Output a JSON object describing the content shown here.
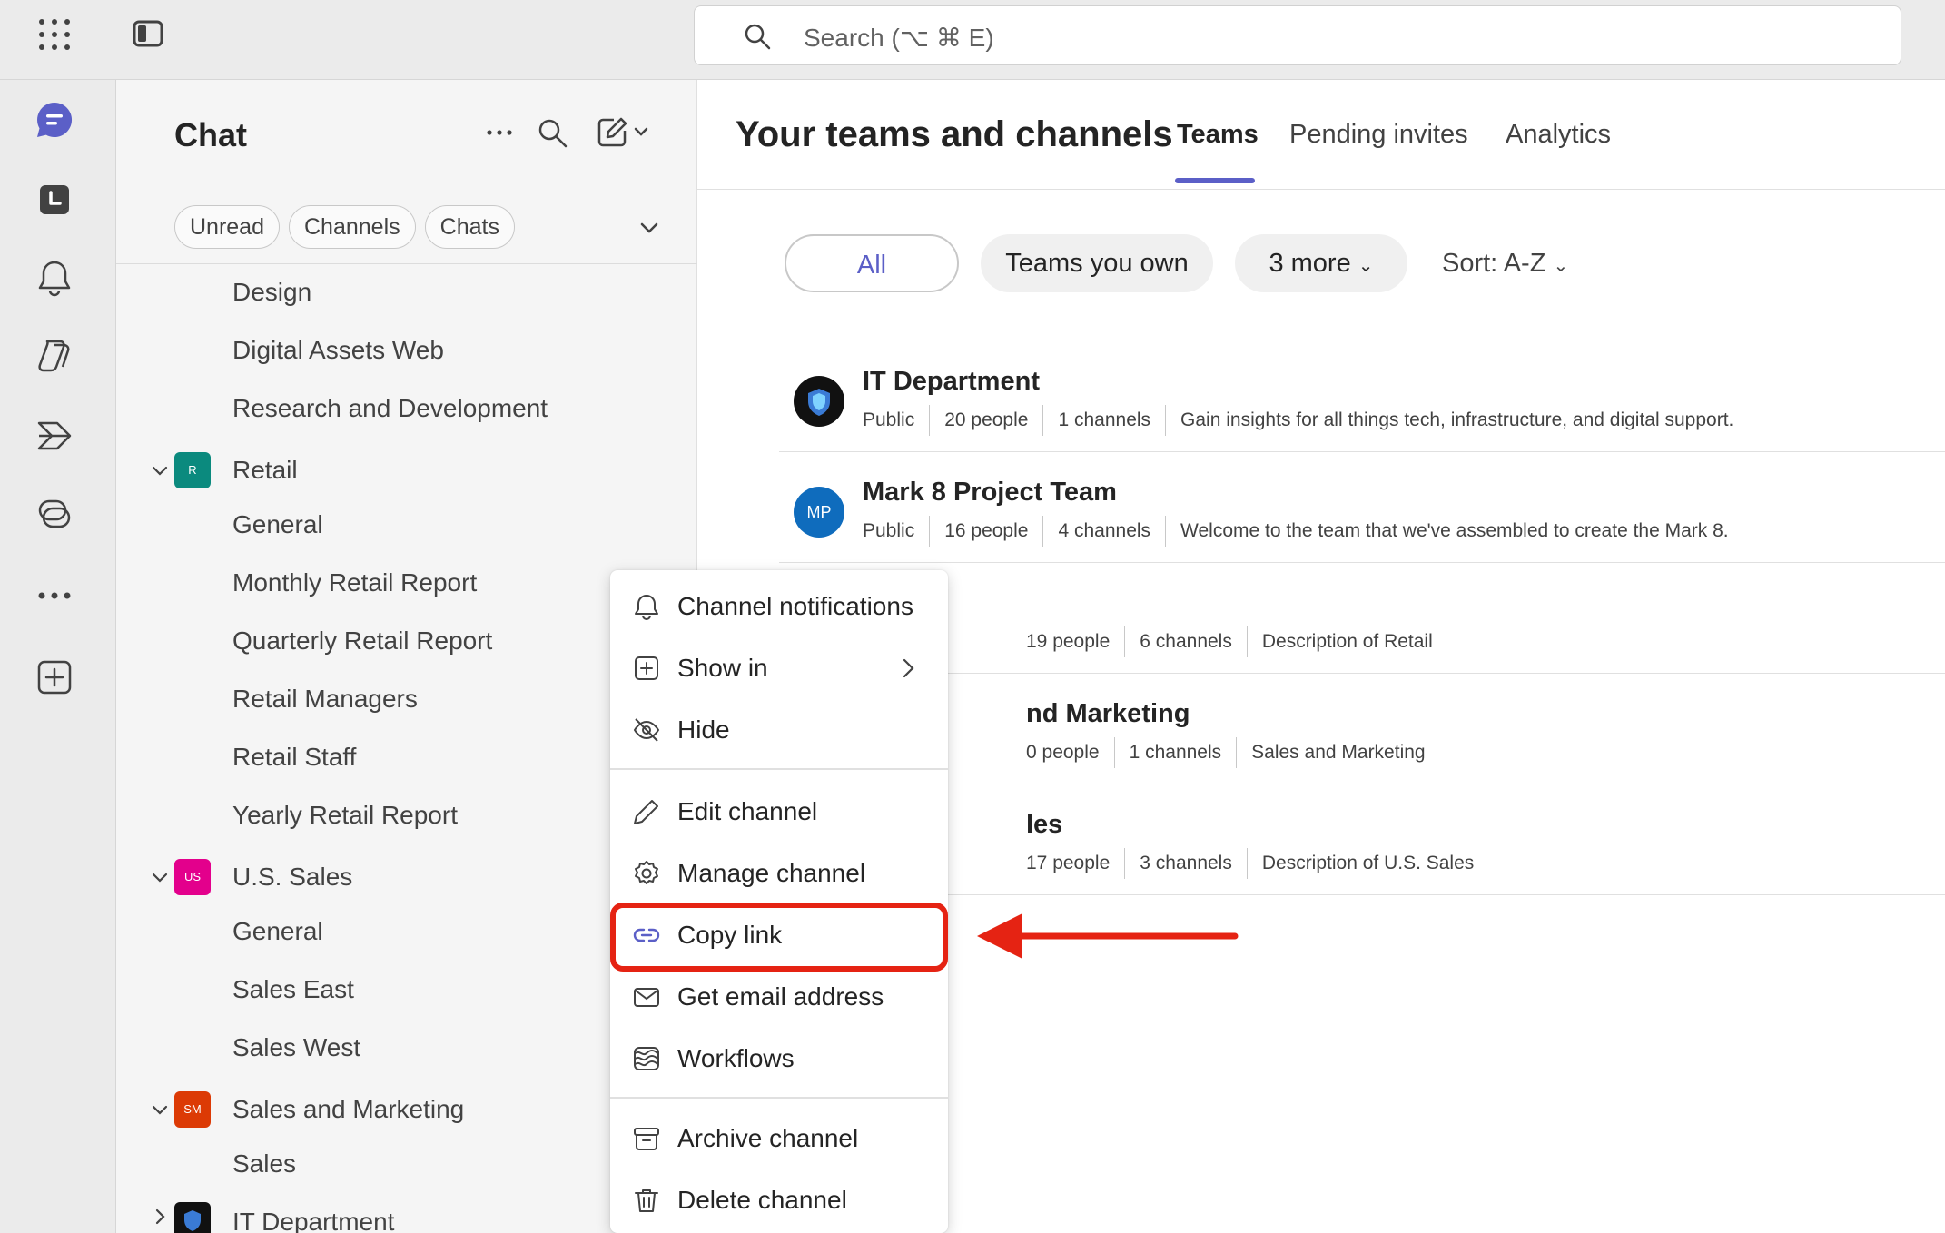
{
  "topbar": {
    "search_placeholder": "Search (⌥ ⌘ E)",
    "icons": [
      "apps-grid-icon",
      "sidebar-toggle-icon",
      "search-icon"
    ]
  },
  "rail": {
    "icons": [
      "chat-icon",
      "calendar-icon",
      "bell-icon",
      "copilot-icon",
      "viva-icon",
      "loop-icon",
      "more-icon",
      "add-app-icon"
    ]
  },
  "chat": {
    "title": "Chat",
    "filters": [
      "Unread",
      "Channels",
      "Chats"
    ],
    "tree": [
      {
        "label": "Design",
        "type": "channel"
      },
      {
        "label": "Digital Assets Web",
        "type": "channel"
      },
      {
        "label": "Research and Development",
        "type": "channel"
      },
      {
        "label": "Retail",
        "type": "team",
        "badge": "R",
        "badge_color": "#0b8a7e"
      },
      {
        "label": "General",
        "type": "channel"
      },
      {
        "label": "Monthly Retail Report",
        "type": "channel"
      },
      {
        "label": "Quarterly Retail Report",
        "type": "channel"
      },
      {
        "label": "Retail Managers",
        "type": "channel"
      },
      {
        "label": "Retail Staff",
        "type": "channel"
      },
      {
        "label": "Yearly Retail Report",
        "type": "channel"
      },
      {
        "label": "U.S. Sales",
        "type": "team",
        "badge": "US",
        "badge_color": "#e3008c"
      },
      {
        "label": "General",
        "type": "channel"
      },
      {
        "label": "Sales East",
        "type": "channel"
      },
      {
        "label": "Sales West",
        "type": "channel"
      },
      {
        "label": "Sales and Marketing",
        "type": "team",
        "badge": "SM",
        "badge_color": "#dc3a05"
      },
      {
        "label": "Sales",
        "type": "channel"
      },
      {
        "label": "IT Department",
        "type": "team",
        "badge": "",
        "badge_color": "#111111"
      }
    ]
  },
  "main": {
    "title": "Your teams and channels",
    "tabs": [
      "Teams",
      "Pending invites",
      "Analytics"
    ],
    "active_tab": "Teams",
    "filter_pills": {
      "all": "All",
      "own": "Teams you own",
      "more": "3 more",
      "sort": "Sort: A-Z"
    },
    "teams": [
      {
        "name": "IT Department",
        "visibility": "Public",
        "people": "20 people",
        "channels": "1 channels",
        "description": "Gain insights for all things tech, infrastructure, and digital support.",
        "avatar": "",
        "avatar_color": "#111111"
      },
      {
        "name": "Mark 8 Project Team",
        "visibility": "Public",
        "people": "16 people",
        "channels": "4 channels",
        "description": "Welcome to the team that we've assembled to create the Mark 8.",
        "avatar": "MP",
        "avatar_color": "#0f6cbd"
      },
      {
        "name": "",
        "visibility": "",
        "people": "19 people",
        "channels": "6 channels",
        "description": "Description of Retail"
      },
      {
        "name": "nd Marketing",
        "visibility": "",
        "people": "0 people",
        "channels": "1 channels",
        "description": "Sales and Marketing"
      },
      {
        "name": "les",
        "visibility": "",
        "people": "17 people",
        "channels": "3 channels",
        "description": "Description of U.S. Sales"
      }
    ]
  },
  "context_menu": {
    "items": [
      {
        "label": "Channel notifications",
        "icon": "bell-icon"
      },
      {
        "label": "Show in",
        "icon": "show-in-icon"
      },
      {
        "label": "Hide",
        "icon": "eye-off-icon"
      },
      {
        "label": "Edit channel",
        "icon": "pencil-icon"
      },
      {
        "label": "Manage channel",
        "icon": "gear-icon"
      },
      {
        "label": "Copy link",
        "icon": "link-icon"
      },
      {
        "label": "Get email address",
        "icon": "mail-icon"
      },
      {
        "label": "Workflows",
        "icon": "workflows-icon"
      },
      {
        "label": "Archive channel",
        "icon": "archive-icon"
      },
      {
        "label": "Delete channel",
        "icon": "trash-icon"
      }
    ],
    "highlighted_item": "Copy link",
    "highlight_color": "#e52313"
  },
  "colors": {
    "accent": "#5b5fc7",
    "annotation": "#e52313"
  }
}
